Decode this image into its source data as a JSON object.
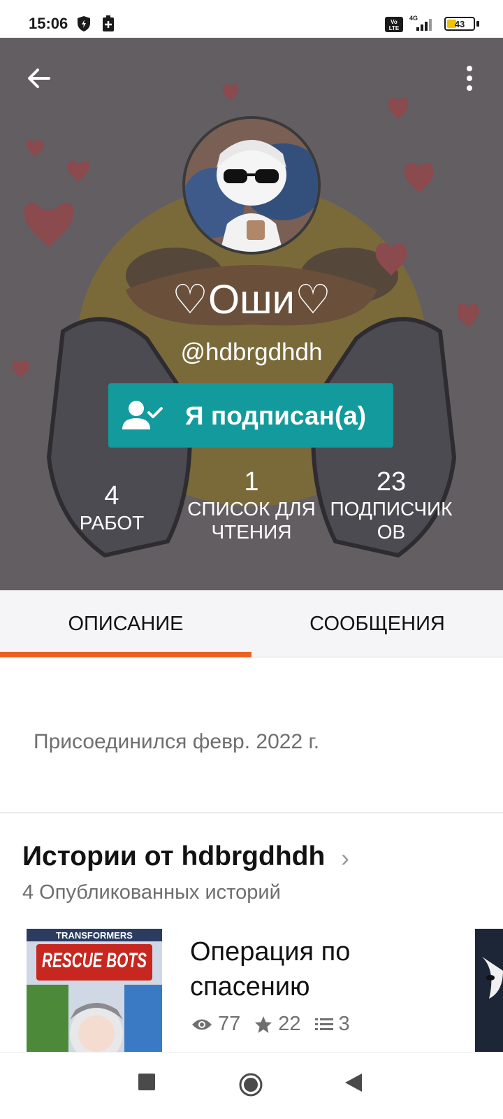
{
  "status_bar": {
    "time": "15:06",
    "battery_level": "43",
    "network": "4G"
  },
  "profile": {
    "display_name": "♡Оши♡",
    "username": "@hdbrgdhdh",
    "follow_button_label": "Я подписан(а)",
    "stats": [
      {
        "number": "4",
        "label": "РАБОТ"
      },
      {
        "number": "1",
        "label": "СПИСОК ДЛЯ ЧТЕНИЯ"
      },
      {
        "number": "23",
        "label": "ПОДПИСЧИК ОВ"
      }
    ]
  },
  "tabs": [
    {
      "label": "ОПИСАНИЕ",
      "active": true
    },
    {
      "label": "СООБЩЕНИЯ",
      "active": false
    }
  ],
  "about": {
    "joined": "Присоединился февр. 2022 г."
  },
  "stories_section": {
    "title": "Истории от hdbrgdhdh",
    "subtitle": "4 Опубликованных историй",
    "stories": [
      {
        "title": "Операция по спасению",
        "cover_text_top": "TRANSFORMERS",
        "cover_text_main": "RESCUE BOTS",
        "views": "77",
        "votes": "22",
        "parts": "3"
      }
    ]
  },
  "colors": {
    "accent": "#eb6123",
    "follow_button": "#129a9c",
    "header_overlay": "#5f5c60"
  },
  "icons": {
    "back": "arrow-left-icon",
    "more": "more-vertical-icon",
    "follow": "user-check-icon",
    "views": "eye-icon",
    "votes": "star-icon",
    "parts": "list-icon"
  }
}
